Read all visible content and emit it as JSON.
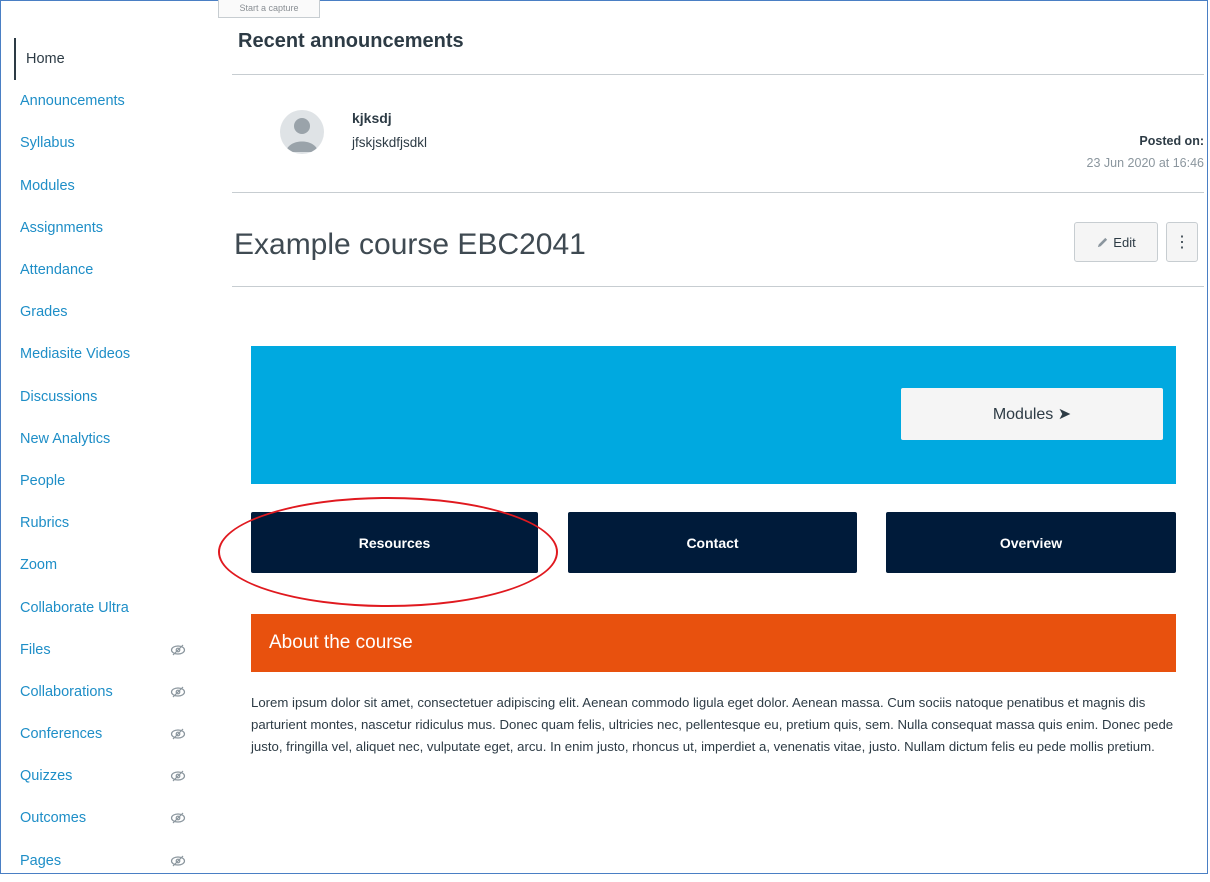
{
  "capture_tag": "Start a capture",
  "sidebar": {
    "items": [
      {
        "label": "Home",
        "active": true,
        "hidden": false
      },
      {
        "label": "Announcements",
        "active": false,
        "hidden": false
      },
      {
        "label": "Syllabus",
        "active": false,
        "hidden": false
      },
      {
        "label": "Modules",
        "active": false,
        "hidden": false
      },
      {
        "label": "Assignments",
        "active": false,
        "hidden": false
      },
      {
        "label": "Attendance",
        "active": false,
        "hidden": false
      },
      {
        "label": "Grades",
        "active": false,
        "hidden": false
      },
      {
        "label": "Mediasite Videos",
        "active": false,
        "hidden": false
      },
      {
        "label": "Discussions",
        "active": false,
        "hidden": false
      },
      {
        "label": "New Analytics",
        "active": false,
        "hidden": false
      },
      {
        "label": "People",
        "active": false,
        "hidden": false
      },
      {
        "label": "Rubrics",
        "active": false,
        "hidden": false
      },
      {
        "label": "Zoom",
        "active": false,
        "hidden": false
      },
      {
        "label": "Collaborate Ultra",
        "active": false,
        "hidden": false
      },
      {
        "label": "Files",
        "active": false,
        "hidden": true
      },
      {
        "label": "Collaborations",
        "active": false,
        "hidden": true
      },
      {
        "label": "Conferences",
        "active": false,
        "hidden": true
      },
      {
        "label": "Quizzes",
        "active": false,
        "hidden": true
      },
      {
        "label": "Outcomes",
        "active": false,
        "hidden": true
      },
      {
        "label": "Pages",
        "active": false,
        "hidden": true
      }
    ]
  },
  "announcements": {
    "heading": "Recent announcements",
    "item": {
      "title": "kjksdj",
      "body": "jfskjskdfjsdkl",
      "posted_label": "Posted on:",
      "posted_date": "23 Jun 2020 at 16:46"
    }
  },
  "course": {
    "title": "Example course EBC2041",
    "edit_label": "Edit",
    "more_label": "⋮"
  },
  "banner": {
    "color": "#00a9e0",
    "modules_label": "Modules ➤"
  },
  "nav_buttons": [
    {
      "label": "Resources"
    },
    {
      "label": "Contact"
    },
    {
      "label": "Overview"
    }
  ],
  "about": {
    "heading": "About the course",
    "color": "#e8510e",
    "text": "Lorem ipsum dolor sit amet, consectetuer adipiscing elit. Aenean commodo ligula eget dolor. Aenean massa. Cum sociis natoque penatibus et magnis dis parturient montes, nascetur ridiculus mus. Donec quam felis, ultricies nec, pellentesque eu, pretium quis, sem. Nulla consequat massa quis enim. Donec pede justo, fringilla vel, aliquet nec, vulputate eget, arcu. In enim justo, rhoncus ut, imperdiet a, venenatis vitae, justo. Nullam dictum felis eu pede mollis pretium."
  },
  "colors": {
    "link": "#1e8ec7",
    "nav_button": "#001b3a",
    "highlight_ellipse": "#e0191f"
  },
  "icons": {
    "hidden_nav": "eye-slash-icon",
    "avatar": "user-avatar-icon",
    "edit": "pencil-icon",
    "more": "kebab-menu-icon"
  }
}
